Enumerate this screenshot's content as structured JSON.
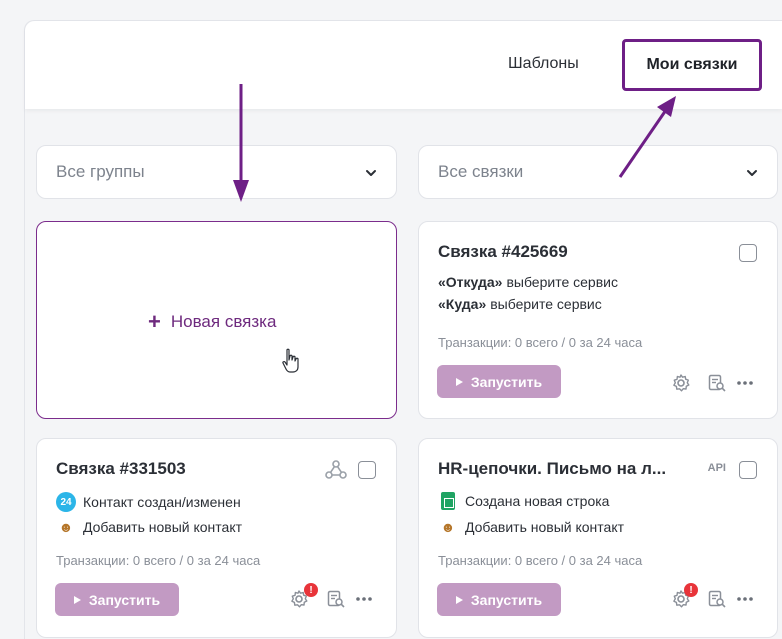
{
  "tabs": {
    "templates": "Шаблоны",
    "mine": "Мои связки"
  },
  "filters": {
    "groups": "Все группы",
    "links": "Все связки"
  },
  "new_card": {
    "plus": "+",
    "label": "Новая связка"
  },
  "cards": [
    {
      "title": "Связка #425669",
      "from_label": "«Откуда»",
      "from_text": "выберите сервис",
      "to_label": "«Куда»",
      "to_text": "выберите сервис",
      "transactions": "Транзакции: 0 всего / 0 за 24 часа",
      "run": "Запустить"
    },
    {
      "title": "Связка #331503",
      "source_badge": "24",
      "source_text": "Контакт создан/изменен",
      "target_text": "Добавить новый контакт",
      "transactions": "Транзакции: 0 всего / 0 за 24 часа",
      "run": "Запустить",
      "alert": "!"
    },
    {
      "title": "HR-цепочки. Письмо на л...",
      "tag": "API",
      "source_text": "Создана новая строка",
      "target_text": "Добавить новый контакт",
      "transactions": "Транзакции: 0 всего / 0 за 24 часа",
      "run": "Запустить",
      "alert": "!"
    }
  ],
  "colors": {
    "accent": "#6e1f86",
    "run_button": "#c29ac3",
    "alert": "#e8343a"
  }
}
